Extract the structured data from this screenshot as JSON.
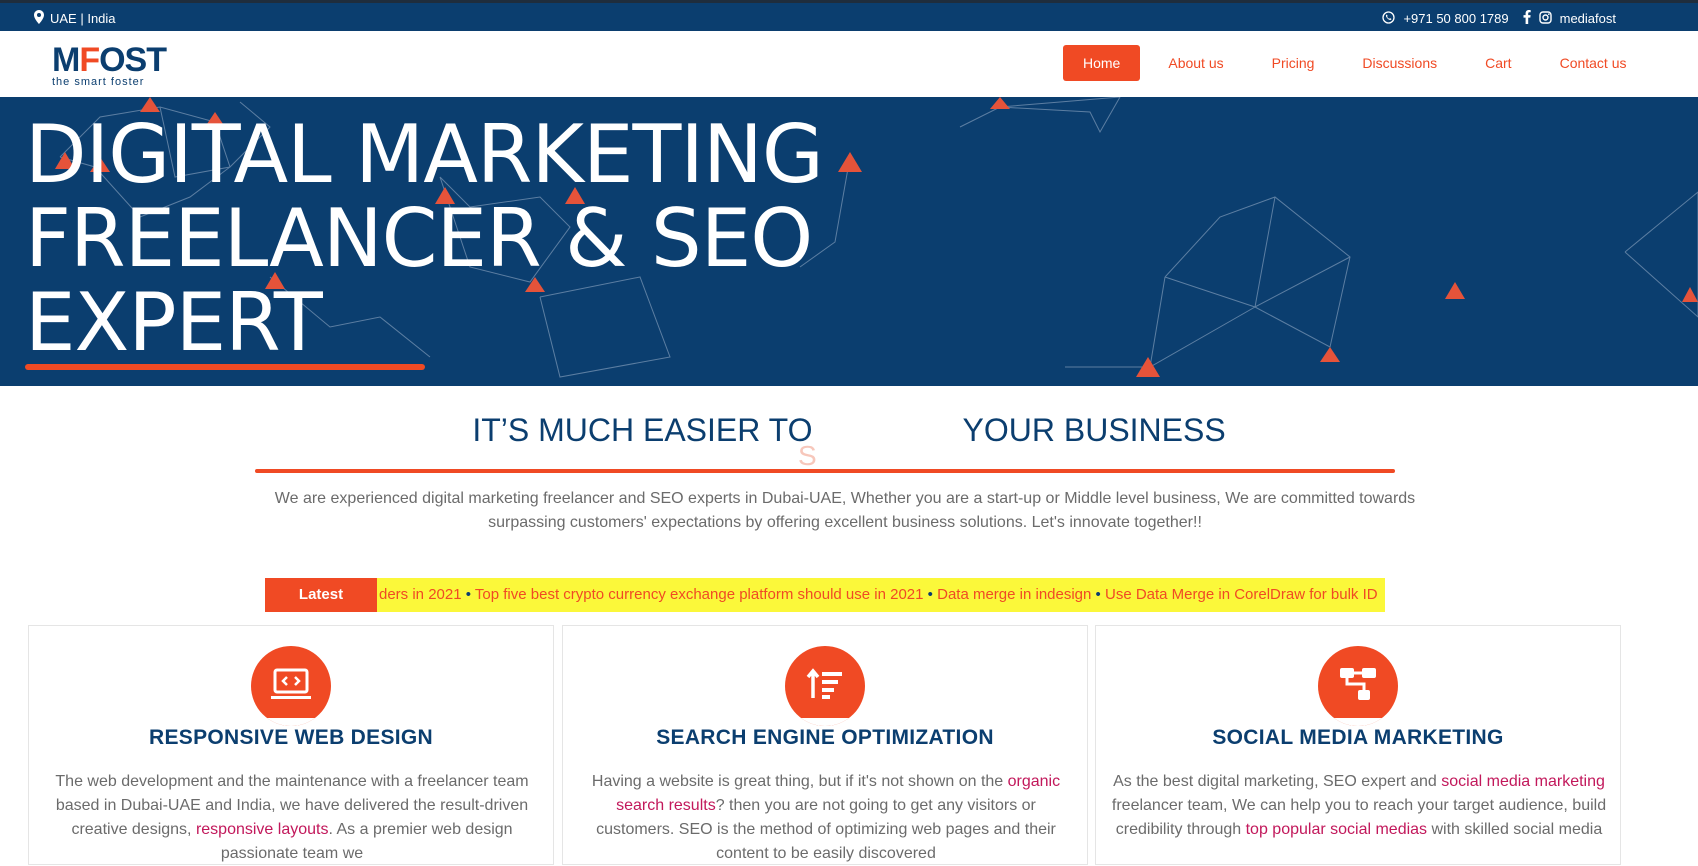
{
  "topbar": {
    "location": "UAE | India",
    "phone": "+971 50 800 1789",
    "instagram": "mediafost",
    "icons": [
      "map-pin-icon",
      "whatsapp-icon",
      "facebook-icon",
      "instagram-icon"
    ]
  },
  "brand": {
    "logo_main": "MFOST",
    "logo_tag": "the smart foster"
  },
  "nav": {
    "items": [
      {
        "label": "Home",
        "active": true
      },
      {
        "label": "About us"
      },
      {
        "label": "Pricing"
      },
      {
        "label": "Discussions"
      },
      {
        "label": "Cart"
      },
      {
        "label": "Contact us"
      }
    ]
  },
  "hero": {
    "line1": "DIGITAL MARKETING",
    "line2": "FREELANCER & SEO",
    "line3": "EXPERT"
  },
  "tagline": {
    "left": "IT’S MUCH EASIER TO",
    "right": "YOUR BUSINESS",
    "ghost": "S"
  },
  "intro": {
    "text": "We are experienced digital marketing freelancer and SEO experts in Dubai-UAE, Whether you are a start-up or Middle level business, We are committed towards surpassing customers' expectations by offering excellent business solutions.  Let's innovate together!!"
  },
  "ticker": {
    "label": "Latest",
    "items": [
      "ders in 2021",
      "Top five best crypto currency exchange platform should use in 2021",
      "Data merge in indesign",
      "Use Data Merge in CorelDraw for bulk ID"
    ],
    "separator": "•"
  },
  "cards": [
    {
      "title": "RESPONSIVE WEB DESIGN",
      "icon": "laptop-code-icon",
      "text_a": "The web development and the maintenance with a freelancer team based in Dubai-UAE and India, we have delivered the result-driven creative designs, ",
      "link": "responsive layouts",
      "text_b": ". As a premier web design passionate team we"
    },
    {
      "title": "SEARCH ENGINE OPTIMIZATION",
      "icon": "sort-amount-icon",
      "text_a": "Having a website is great thing, but if it's not shown on the ",
      "link": "organic search results",
      "text_b": "? then you are not going to get any visitors or customers. SEO is the method of optimizing web pages and their content to be easily discovered"
    },
    {
      "title": "SOCIAL MEDIA MARKETING",
      "icon": "sitemap-icon",
      "text_a": "As the best digital marketing, SEO expert and ",
      "link": "social media marketing",
      "text_b": " freelancer team, We can help you to reach your target audience, build credibility through ",
      "link2": "top popular social medias",
      "text_c": " with skilled social media"
    }
  ],
  "colors": {
    "navy": "#0b3e6f",
    "accent": "#f04a24",
    "ticker_bg": "#fbf83a"
  }
}
